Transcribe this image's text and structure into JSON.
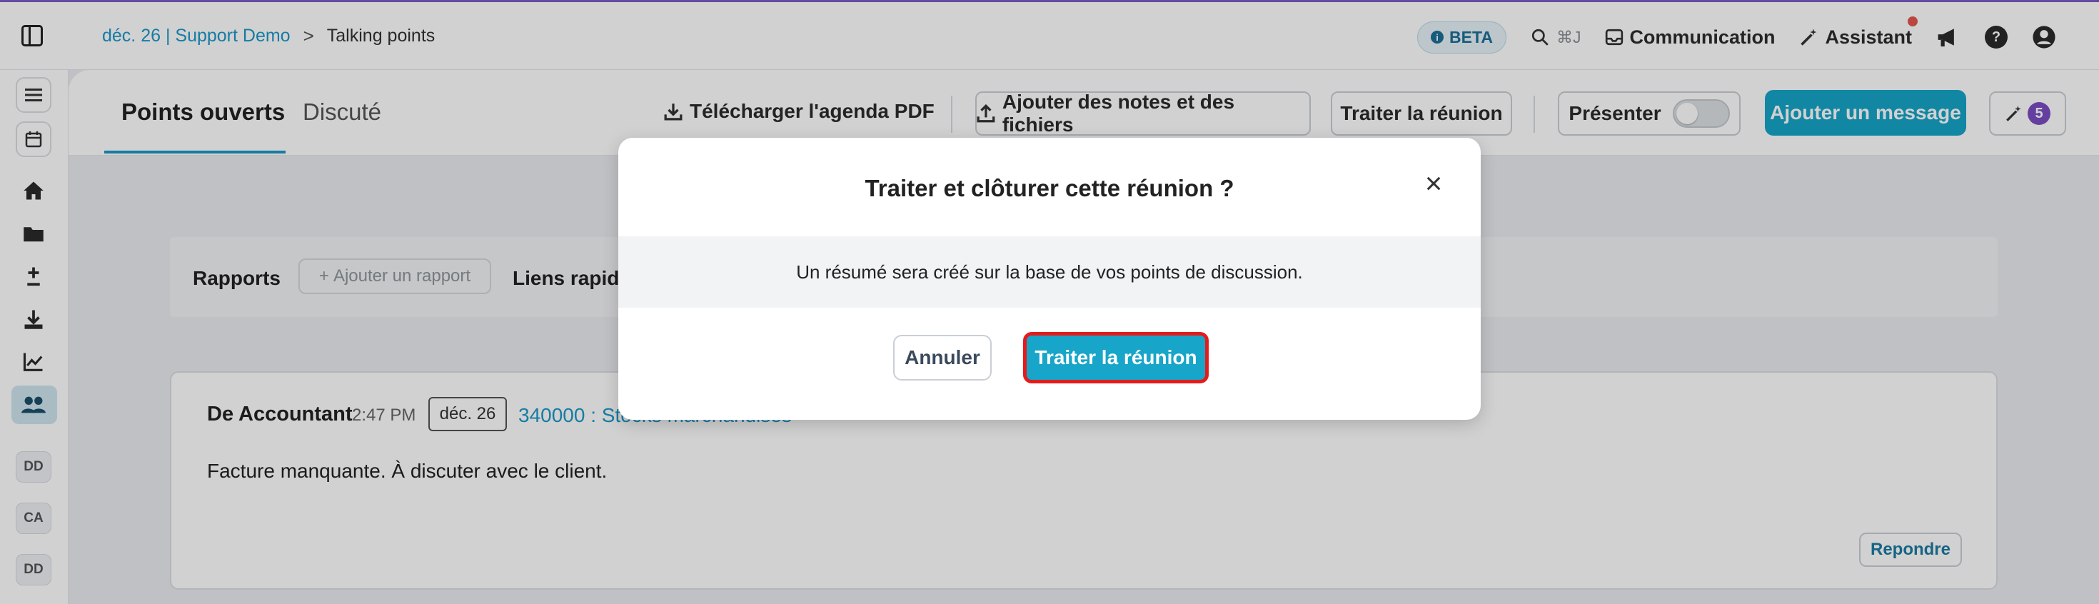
{
  "header": {
    "breadcrumb_link": "déc. 26 | Support Demo",
    "breadcrumb_separator": ">",
    "breadcrumb_current": "Talking points",
    "beta_label": "BETA",
    "search_shortcut": "⌘J",
    "communication_label": "Communication",
    "assistant_label": "Assistant"
  },
  "sidebar": {
    "avatars": [
      "DD",
      "CA",
      "DD"
    ]
  },
  "tabs": {
    "open": "Points ouverts",
    "discussed": "Discuté"
  },
  "toolbar": {
    "download_pdf": "Télécharger l'agenda PDF",
    "add_notes": "Ajouter des notes et des fichiers",
    "process_meeting": "Traiter la réunion",
    "present": "Présenter",
    "add_message": "Ajouter un message",
    "assistant_count": "5"
  },
  "reports": {
    "title": "Rapports",
    "add_report": "Ajouter un rapport",
    "quick_links": "Liens rapides"
  },
  "message": {
    "author": "De Accountant",
    "time": "2:47 PM",
    "date": "déc. 26",
    "link": "340000 : Stocks marchandises",
    "body": "Facture manquante. À discuter avec le client.",
    "reply": "Repondre"
  },
  "modal": {
    "title": "Traiter et clôturer cette réunion ?",
    "close": "×",
    "text": "Un résumé sera créé sur la base de vos points de discussion.",
    "cancel": "Annuler",
    "confirm": "Traiter la réunion"
  },
  "colors": {
    "accent": "#17a5c9",
    "link": "#1a98c9",
    "highlight_border": "#e51b1b",
    "badge_purple": "#7c4dc4"
  },
  "icons": [
    "sidebar-toggle-icon",
    "info-icon",
    "search-icon",
    "inbox-icon",
    "magic-wand-icon",
    "megaphone-icon",
    "help-icon",
    "user-icon",
    "menu-icon",
    "calendar-icon",
    "home-icon",
    "folder-icon",
    "plus-minus-icon",
    "download-icon",
    "chart-icon",
    "users-icon",
    "upload-icon",
    "close-icon"
  ]
}
